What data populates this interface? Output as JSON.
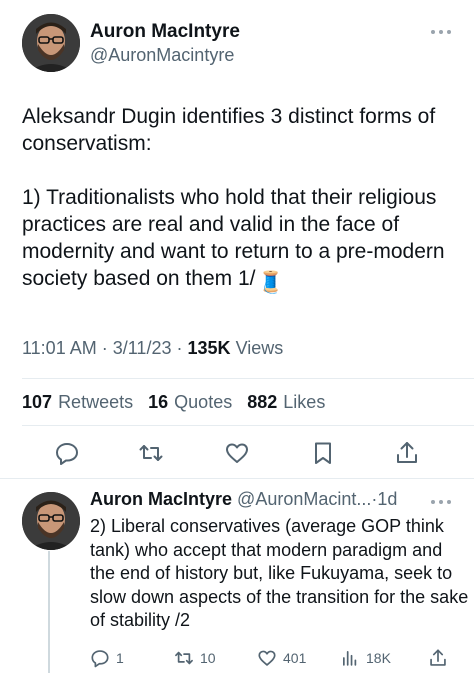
{
  "main_tweet": {
    "author": {
      "display_name": "Auron MacIntyre",
      "handle": "@AuronMacintyre"
    },
    "text": "Aleksandr Dugin identifies 3 distinct forms of conservatism:\n\n1) Traditionalists who hold that their religious practices are real and valid in the face of modernity and want to return to a pre-modern society based on them 1/",
    "thread_emoji": "🧵",
    "time": "11:01 AM",
    "date": "3/11/23",
    "separator": "·",
    "views_count": "135K",
    "views_label": "Views",
    "stats": {
      "retweets_count": "107",
      "retweets_label": "Retweets",
      "quotes_count": "16",
      "quotes_label": "Quotes",
      "likes_count": "882",
      "likes_label": "Likes"
    },
    "actions": [
      "reply-icon",
      "retweet-icon",
      "like-icon",
      "bookmark-icon",
      "share-icon"
    ]
  },
  "reply_tweet": {
    "author": {
      "display_name": "Auron MacIntyre",
      "handle": "@AuronMacint...",
      "separator": "·",
      "age": "1d"
    },
    "text": "2) Liberal conservatives (average GOP think tank) who accept that modern paradigm and the end of history but, like Fukuyama, seek to slow down aspects of the transition for the sake of stability /2",
    "actions": {
      "replies": "1",
      "retweets": "10",
      "likes": "401",
      "views": "18K"
    }
  },
  "colors": {
    "text_primary": "#0f1419",
    "text_secondary": "#536471",
    "divider": "#e6ecf0",
    "thread_line": "#cfd9de"
  }
}
